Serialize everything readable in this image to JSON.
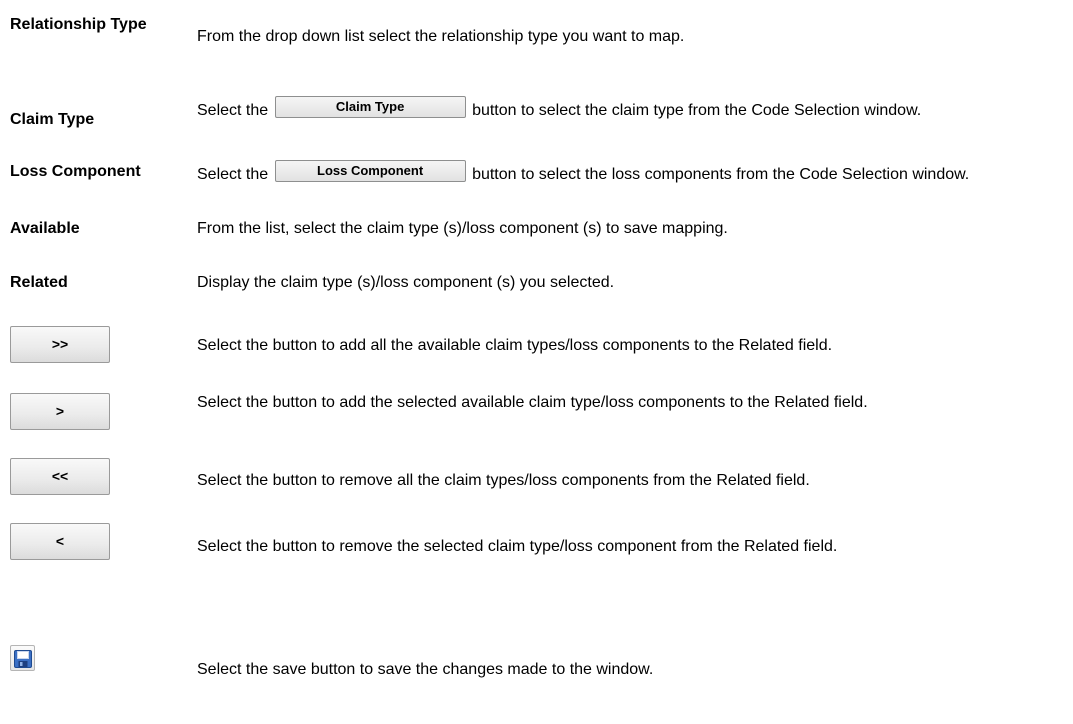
{
  "rows": [
    {
      "term": "Relationship Type",
      "desc": "From the drop down list select the relationship type you want to map."
    },
    {
      "term": "Claim Type",
      "desc_before": "Select the",
      "button": "Claim Type",
      "desc_after": "button to select the claim type from the Code Selection window."
    },
    {
      "term": "Loss Component",
      "desc_before": "Select the",
      "button": "Loss Component",
      "desc_after": "button to select the loss components from the Code Selection window."
    },
    {
      "term": "Available",
      "desc": "From the list, select the claim type (s)/loss component (s) to save mapping."
    },
    {
      "term": "Related",
      "desc": "Display the claim type (s)/loss component (s) you selected."
    }
  ],
  "buttons": [
    {
      "label": ">>",
      "desc": "Select the button to add all the available claim types/loss components to the Related field."
    },
    {
      "label": ">",
      "desc": "Select the button to add the selected available claim type/loss components to the Related field."
    },
    {
      "label": "<<",
      "desc": "Select the button to remove all the claim types/loss components from the Related field."
    },
    {
      "label": "<",
      "desc": "Select the button to remove the selected claim type/loss component from the Related field."
    }
  ],
  "save": {
    "icon": "floppy-disk-icon",
    "desc": "Select the save button to save the changes made to the window."
  }
}
